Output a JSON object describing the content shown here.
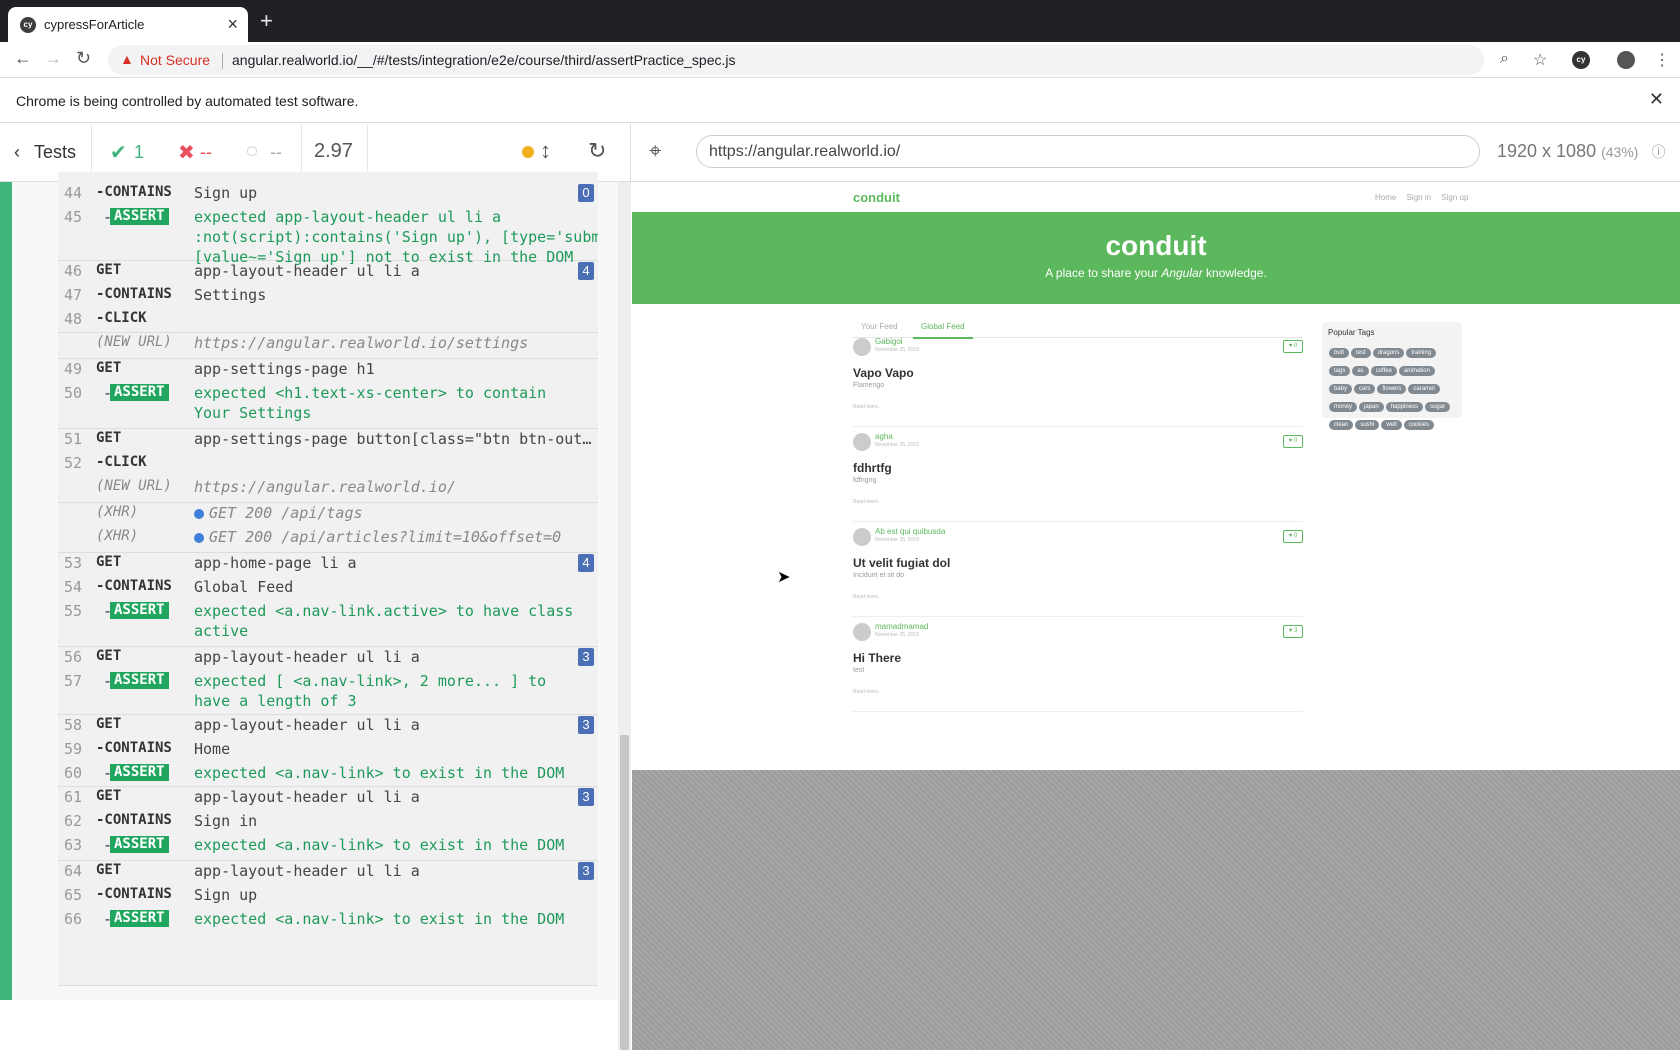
{
  "browser": {
    "tab_title": "cypressForArticle",
    "favicon_text": "cy",
    "address_warning": "Not Secure",
    "address_url": "angular.realworld.io/__/#/tests/integration/e2e/course/third/assertPractice_spec.js",
    "infobar_message": "Chrome is being controlled by automated test software."
  },
  "reporter": {
    "tests_label": "Tests",
    "passed": "1",
    "failed": "--",
    "pending": "--",
    "duration": "2.97",
    "commands": [
      {
        "line": "44",
        "name": "-CONTAINS",
        "msg": "Sign up",
        "badge": "0"
      },
      {
        "line": "45",
        "name": "ASSERT",
        "msg1": "expected app-layout-header ul li a",
        "msg2": ":not(script):contains('Sign up'), [type='submit']",
        "msg3": "[value~='Sign up'] not to exist in the DOM"
      },
      {
        "line": "46",
        "name": "GET",
        "msg": "app-layout-header ul li a",
        "badge": "4"
      },
      {
        "line": "47",
        "name": "-CONTAINS",
        "msg": "Settings"
      },
      {
        "line": "48",
        "name": "-CLICK",
        "msg": ""
      },
      {
        "line": "",
        "name": "(NEW URL)",
        "msg": "https://angular.realworld.io/settings"
      },
      {
        "line": "49",
        "name": "GET",
        "msg": "app-settings-page h1"
      },
      {
        "line": "50",
        "name": "ASSERT",
        "msg1": "expected <h1.text-xs-center> to contain",
        "msg2": "Your Settings"
      },
      {
        "line": "51",
        "name": "GET",
        "msg": "app-settings-page button[class=\"btn btn-out…"
      },
      {
        "line": "52",
        "name": "-CLICK",
        "msg": ""
      },
      {
        "line": "",
        "name": "(NEW URL)",
        "msg": "https://angular.realworld.io/"
      },
      {
        "line": "",
        "name": "(XHR)",
        "msg": "GET 200 /api/tags"
      },
      {
        "line": "",
        "name": "(XHR)",
        "msg": "GET 200 /api/articles?limit=10&offset=0"
      },
      {
        "line": "53",
        "name": "GET",
        "msg": "app-home-page li a",
        "badge": "4"
      },
      {
        "line": "54",
        "name": "-CONTAINS",
        "msg": "Global Feed"
      },
      {
        "line": "55",
        "name": "ASSERT",
        "msg1": "expected <a.nav-link.active> to have class",
        "msg2": "active"
      },
      {
        "line": "56",
        "name": "GET",
        "msg": "app-layout-header ul li a",
        "badge": "3"
      },
      {
        "line": "57",
        "name": "ASSERT",
        "msg1": "expected [ <a.nav-link>, 2 more... ] to",
        "msg2": "have a length of 3"
      },
      {
        "line": "58",
        "name": "GET",
        "msg": "app-layout-header ul li a",
        "badge": "3"
      },
      {
        "line": "59",
        "name": "-CONTAINS",
        "msg": "Home"
      },
      {
        "line": "60",
        "name": "ASSERT",
        "msg1": "expected <a.nav-link> to exist in the DOM"
      },
      {
        "line": "61",
        "name": "GET",
        "msg": "app-layout-header ul li a",
        "badge": "3"
      },
      {
        "line": "62",
        "name": "-CONTAINS",
        "msg": "Sign in"
      },
      {
        "line": "63",
        "name": "ASSERT",
        "msg1": "expected <a.nav-link> to exist in the DOM"
      },
      {
        "line": "64",
        "name": "GET",
        "msg": "app-layout-header ul li a",
        "badge": "3"
      },
      {
        "line": "65",
        "name": "-CONTAINS",
        "msg": "Sign up"
      },
      {
        "line": "66",
        "name": "ASSERT",
        "msg1": "expected <a.nav-link> to exist in the DOM"
      }
    ]
  },
  "aut": {
    "url": "https://angular.realworld.io/",
    "viewport": "1920 x 1080",
    "scale": "(43%)",
    "app": {
      "brand": "conduit",
      "nav": [
        "Home",
        "Sign in",
        "Sign up"
      ],
      "banner_title": "conduit",
      "banner_subtitle_pre": "A place to share your ",
      "banner_subtitle_em": "Angular",
      "banner_subtitle_post": " knowledge.",
      "feed_tabs": [
        "Your Feed",
        "Global Feed"
      ],
      "articles": [
        {
          "author": "Gabigol",
          "date": "November 25, 2019",
          "likes": "0",
          "title": "Vapo Vapo",
          "desc": "Flamengo",
          "readmore": "Read more..."
        },
        {
          "author": "agha",
          "date": "November 25, 2019",
          "likes": "0",
          "title": "fdhrtfg",
          "desc": "fdfngng",
          "readmore": "Read more..."
        },
        {
          "author": "Ab est qui quibusda",
          "date": "November 25, 2019",
          "likes": "0",
          "title": "Ut velit fugiat dol",
          "desc": "Incidunt et sit do",
          "readmore": "Read more..."
        },
        {
          "author": "mamadmamad",
          "date": "November 25, 2019",
          "likes": "3",
          "title": "Hi There",
          "desc": "test",
          "readmore": "Read more..."
        }
      ],
      "popular_tags_title": "Popular Tags",
      "tags": [
        "butt",
        "test",
        "dragons",
        "training",
        "tags",
        "as",
        "coffee",
        "animation",
        "baby",
        "cars",
        "flowers",
        "caramel",
        "money",
        "japan",
        "happiness",
        "sugar",
        "clean",
        "sushi",
        "well",
        "cookies"
      ]
    }
  }
}
